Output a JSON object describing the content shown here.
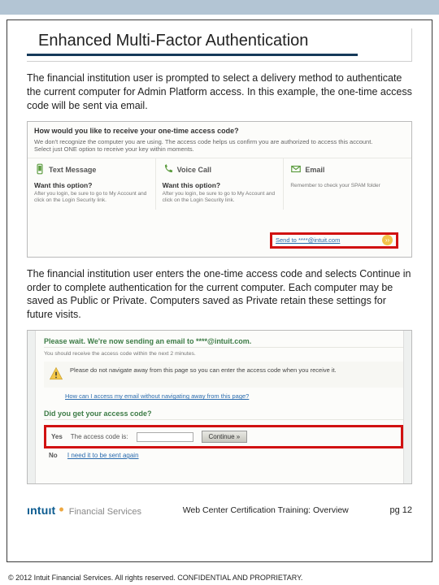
{
  "title": "Enhanced Multi-Factor Authentication",
  "para1": "The financial institution user is prompted to select a delivery method to authenticate the current computer for Admin Platform access. In this example, the one-time access code will be sent via email.",
  "para2": "The financial institution user enters the one-time access code and selects Continue in order to complete authentication for the current computer. Each computer may be saved as Public or Private. Computers saved as Private retain these settings for future visits.",
  "shot1": {
    "heading": "How would you like to receive your one-time access code?",
    "sub1": "We don't recognize the computer you are using. The access code helps us confirm you are authorized to access this account.",
    "sub2": "Select just ONE option to receive your key within moments.",
    "col1": {
      "label": "Text Message",
      "want": "Want this option?",
      "detail": "After you login, be sure to go to My Account and click on the Login Security link."
    },
    "col2": {
      "label": "Voice Call",
      "want": "Want this option?",
      "detail": "After you login, be sure to go to My Account and click on the Login Security link."
    },
    "col3": {
      "label": "Email",
      "note": "Remember to check your SPAM folder",
      "send": "Send to ****@intuit.com"
    }
  },
  "shot2": {
    "heading": "Please wait. We're now sending an email to ****@intuit.com.",
    "sub": "You should receive the access code within the next 2 minutes.",
    "warn": "Please do not navigate away from this page so you can enter the access code when you receive it.",
    "link": "How can I access my email without navigating away from this page?",
    "q": "Did you get your access code?",
    "yes": "Yes",
    "codelabel": "The access code is:",
    "continue": "Continue »",
    "no": "No",
    "resend": "I need it to be sent again"
  },
  "footer": {
    "logo_main": "ıntuıt",
    "logo_sub": "Financial Services",
    "mid": "Web Center Certification Training: Overview",
    "pg": "pg 12"
  },
  "copyright": "© 2012 Intuit Financial Services. All rights reserved. CONFIDENTIAL AND PROPRIETARY."
}
